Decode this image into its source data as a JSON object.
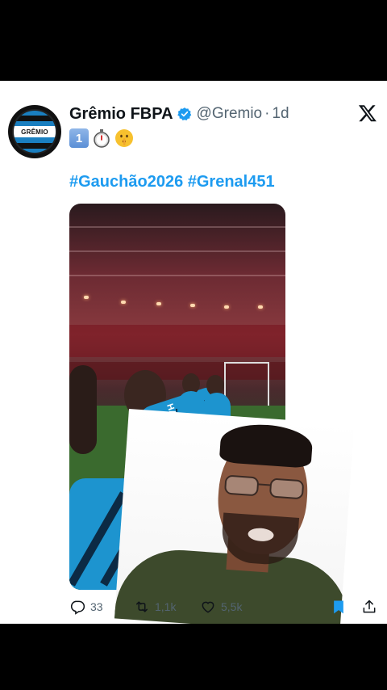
{
  "tweet": {
    "display_name": "Grêmio FBPA",
    "handle": "@Gremio",
    "separator": "·",
    "time": "1d",
    "avatar_text": "GRÊMIO",
    "emoji_keycap": "1",
    "hashtags": "#Gauchão2026 #Grenal451",
    "media_shirt_text": "HAVA"
  },
  "actions": {
    "replies": "33",
    "retweets": "1,1k",
    "likes": "5,5k"
  },
  "icons": {
    "verified": "verified-badge-icon",
    "brand": "x-logo-icon",
    "reply": "reply-icon",
    "retweet": "retweet-icon",
    "like": "heart-icon",
    "bookmark": "bookmark-icon",
    "share": "share-icon"
  },
  "colors": {
    "accent": "#1d9bf0",
    "text_primary": "#0f1419",
    "text_secondary": "#536471",
    "background": "#ffffff",
    "letterbox": "#000000"
  }
}
